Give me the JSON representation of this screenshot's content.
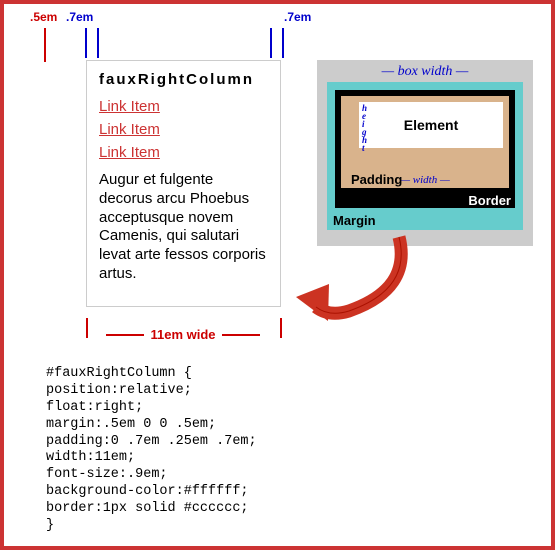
{
  "measurements": {
    "left_margin": ".5em",
    "left_padding": ".7em",
    "right_padding": ".7em"
  },
  "column": {
    "heading": "fauxRightColumn",
    "links": [
      "Link Item",
      "Link Item",
      "Link Item"
    ],
    "paragraph": "Augur et fulgente decorus arcu Phoebus acceptusque novem Camenis, qui salutari levat arte fessos corporis artus.",
    "width_label": "11em wide"
  },
  "boxmodel": {
    "top_label": "— box width —",
    "height_label": "h\ne\ni\ng\nh\nt",
    "width_label": "— width —",
    "element": "Element",
    "padding": "Padding",
    "border": "Border",
    "margin": "Margin"
  },
  "code": "#fauxRightColumn {\nposition:relative;\nfloat:right;\nmargin:.5em 0 0 .5em;\npadding:0 .7em .25em .7em;\nwidth:11em;\nfont-size:.9em;\nbackground-color:#ffffff;\nborder:1px solid #cccccc;\n}"
}
